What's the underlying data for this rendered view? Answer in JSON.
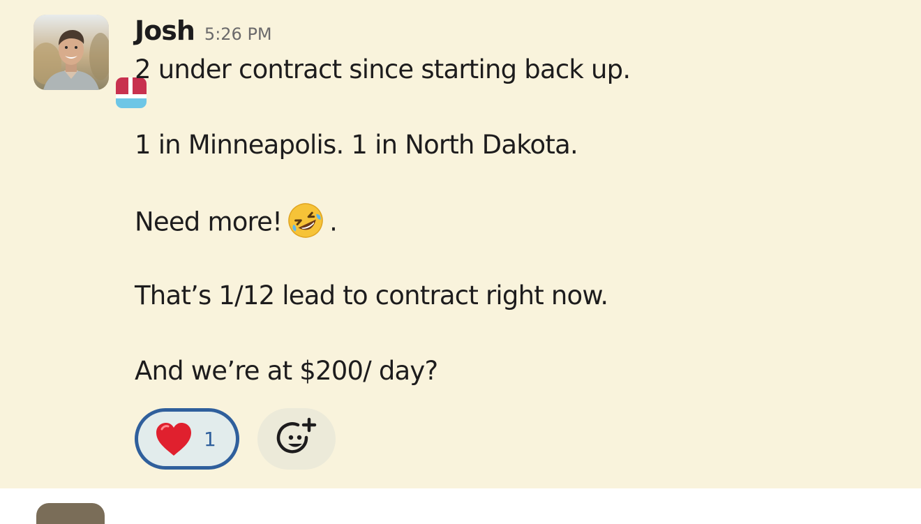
{
  "message": {
    "sender": "Josh",
    "timestamp": "5:26 PM",
    "avatar_icon": "user-photo-avatar",
    "app_badge_icon": "app-badge-icon",
    "lines": [
      "2 under contract since starting back up.",
      "1 in Minneapolis. 1 in North Dakota.",
      "Need more!",
      ".",
      "That’s 1/12 lead to contract right now.",
      "And we’re at $200/ day?"
    ],
    "inline_emoji": "rolling-on-the-floor-laughing-emoji"
  },
  "reactions": [
    {
      "emoji": "red-heart-emoji",
      "count": "1",
      "selected": true
    }
  ],
  "add_reaction_icon": "add-reaction-icon",
  "colors": {
    "highlight_background": "#f9f3dc",
    "reaction_border": "#2f5f9c",
    "reaction_fill": "#e2ecec",
    "timestamp": "#6b6a6b",
    "text": "#1d1c1d"
  }
}
